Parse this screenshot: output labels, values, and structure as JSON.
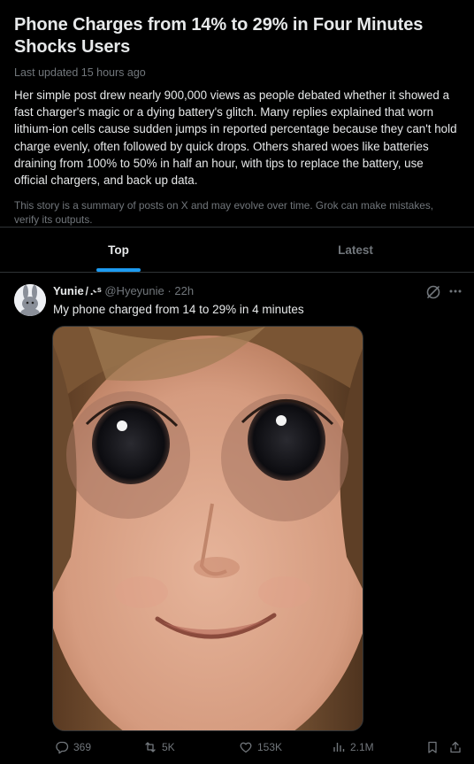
{
  "story": {
    "title": "Phone Charges from 14% to 29% in Four Minutes Shocks Users",
    "updated": "Last updated 15 hours ago",
    "summary": "Her simple post drew nearly 900,000 views as people debated whether it showed a fast charger's magic or a dying battery's glitch. Many replies explained that worn lithium-ion cells cause sudden jumps in reported percentage because they can't hold charge evenly, often followed by quick drops. Others shared woes like batteries draining from 100% to 50% in half an hour, with tips to replace the battery, use official chargers, and back up data.",
    "disclaimer": "This story is a summary of posts on X and may evolve over time. Grok can make mistakes, verify its outputs."
  },
  "tabs": [
    {
      "label": "Top",
      "active": true
    },
    {
      "label": "Latest",
      "active": false
    }
  ],
  "post": {
    "name": "Yunie ̸ .˞ˢ",
    "handle": "@Hyeyunie",
    "separator": "·",
    "time": "22h",
    "text": "My phone charged from 14 to 29% in 4 minutes",
    "actions": {
      "replies": "369",
      "reposts": "5K",
      "likes": "153K",
      "views": "2.1M"
    }
  },
  "colors": {
    "background": "#000000",
    "text": "#e7e9ea",
    "muted": "#71767b",
    "accent": "#1d9bf0",
    "border": "#2f3336"
  },
  "icons": [
    "grok-icon",
    "more-icon",
    "reply-icon",
    "repost-icon",
    "like-icon",
    "views-icon",
    "bookmark-icon",
    "share-icon"
  ]
}
